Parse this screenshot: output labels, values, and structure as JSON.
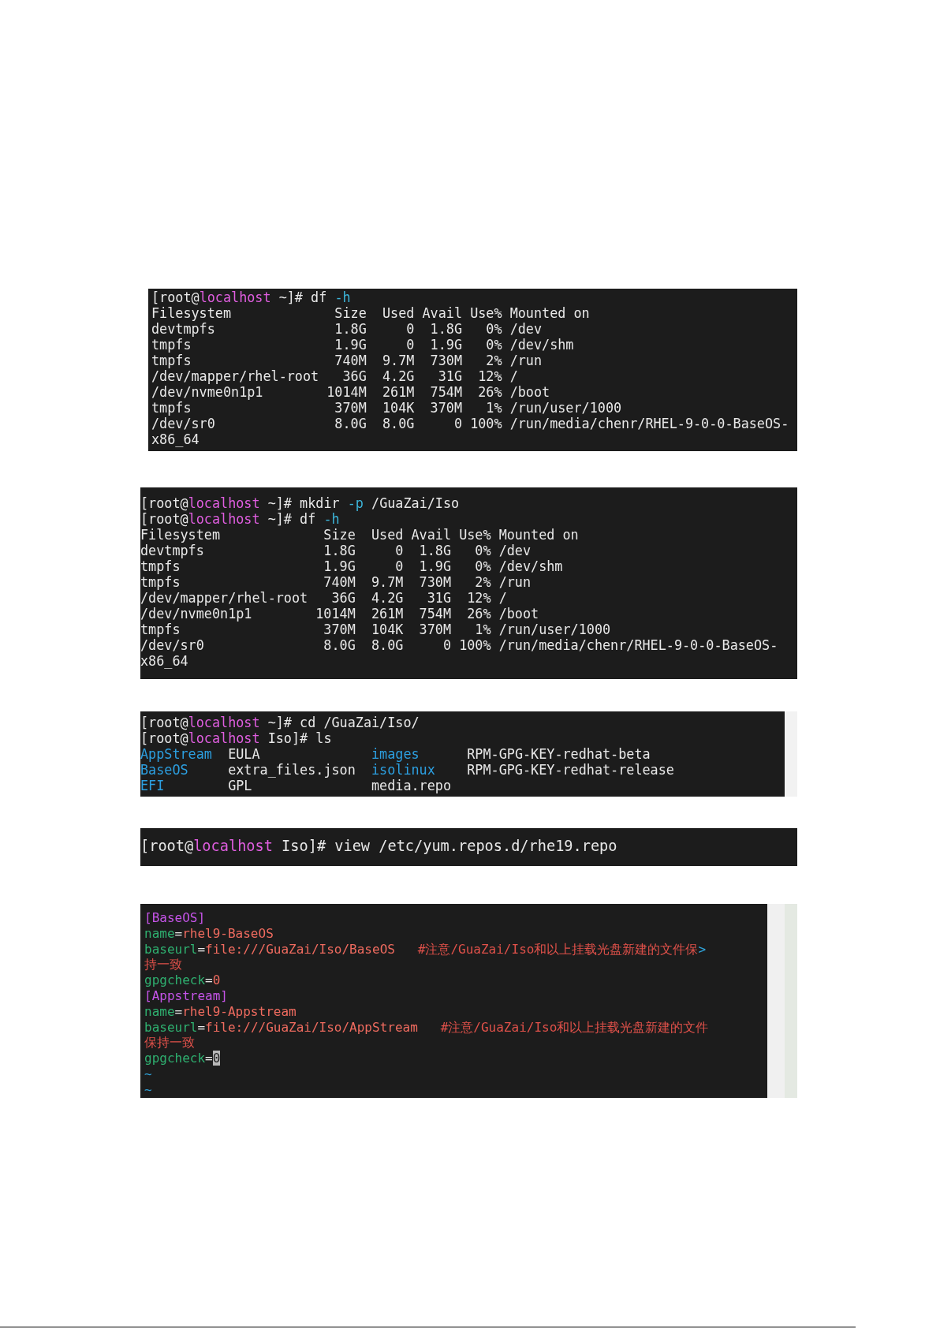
{
  "terminals": [
    {
      "kind": "normal",
      "scrollbar": false,
      "lines": [
        [
          {
            "text": "[root@",
            "kind": "plain"
          },
          {
            "text": "localhost",
            "kind": "host"
          },
          {
            "text": " ~]# df ",
            "kind": "plain"
          },
          {
            "text": "-h",
            "kind": "option"
          }
        ],
        [
          {
            "text": "Filesystem             Size  Used Avail Use% Mounted on",
            "kind": "plain"
          }
        ],
        [
          {
            "text": "devtmpfs               1.8G     0  1.8G   0% /dev",
            "kind": "plain"
          }
        ],
        [
          {
            "text": "tmpfs                  1.9G     0  1.9G   0% /dev/shm",
            "kind": "plain"
          }
        ],
        [
          {
            "text": "tmpfs                  740M  9.7M  730M   2% /run",
            "kind": "plain"
          }
        ],
        [
          {
            "text": "/dev/mapper/rhel-root   36G  4.2G   31G  12% /",
            "kind": "plain"
          }
        ],
        [
          {
            "text": "/dev/nvme0n1p1        1014M  261M  754M  26% /boot",
            "kind": "plain"
          }
        ],
        [
          {
            "text": "tmpfs                  370M  104K  370M   1% /run/user/1000",
            "kind": "plain"
          }
        ],
        [
          {
            "text": "/dev/sr0               8.0G  8.0G     0 100% /run/media/chenr/RHEL-9-0-0-BaseOS-",
            "kind": "plain"
          }
        ],
        [
          {
            "text": "x86_64",
            "kind": "plain"
          }
        ]
      ]
    },
    {
      "kind": "normal",
      "scrollbar": false,
      "lines": [
        [
          {
            "text": "[root@",
            "kind": "plain"
          },
          {
            "text": "localhost",
            "kind": "host"
          },
          {
            "text": " ~]# mkdir ",
            "kind": "plain"
          },
          {
            "text": "-p",
            "kind": "option"
          },
          {
            "text": " /GuaZai/Iso",
            "kind": "plain"
          }
        ],
        [
          {
            "text": "[root@",
            "kind": "plain"
          },
          {
            "text": "localhost",
            "kind": "host"
          },
          {
            "text": " ~]# df ",
            "kind": "plain"
          },
          {
            "text": "-h",
            "kind": "option"
          }
        ],
        [
          {
            "text": "Filesystem             Size  Used Avail Use% Mounted on",
            "kind": "plain"
          }
        ],
        [
          {
            "text": "devtmpfs               1.8G     0  1.8G   0% /dev",
            "kind": "plain"
          }
        ],
        [
          {
            "text": "tmpfs                  1.9G     0  1.9G   0% /dev/shm",
            "kind": "plain"
          }
        ],
        [
          {
            "text": "tmpfs                  740M  9.7M  730M   2% /run",
            "kind": "plain"
          }
        ],
        [
          {
            "text": "/dev/mapper/rhel-root   36G  4.2G   31G  12% /",
            "kind": "plain"
          }
        ],
        [
          {
            "text": "/dev/nvme0n1p1        1014M  261M  754M  26% /boot",
            "kind": "plain"
          }
        ],
        [
          {
            "text": "tmpfs                  370M  104K  370M   1% /run/user/1000",
            "kind": "plain"
          }
        ],
        [
          {
            "text": "/dev/sr0               8.0G  8.0G     0 100% /run/media/chenr/RHEL-9-0-0-BaseOS-",
            "kind": "plain"
          }
        ],
        [
          {
            "text": "x86_64",
            "kind": "plain"
          }
        ]
      ]
    },
    {
      "kind": "normal",
      "scrollbar": true,
      "lines": [
        [
          {
            "text": "[root@",
            "kind": "plain"
          },
          {
            "text": "localhost",
            "kind": "host"
          },
          {
            "text": " ~]# cd /GuaZai/Iso/",
            "kind": "plain"
          }
        ],
        [
          {
            "text": "[root@",
            "kind": "plain"
          },
          {
            "text": "localhost",
            "kind": "host"
          },
          {
            "text": " Iso]# ls",
            "kind": "plain"
          }
        ],
        [
          {
            "text": "AppStream",
            "kind": "dir"
          },
          {
            "text": "  EULA              ",
            "kind": "plain"
          },
          {
            "text": "images",
            "kind": "dir"
          },
          {
            "text": "      RPM-GPG-KEY-redhat-beta",
            "kind": "plain"
          }
        ],
        [
          {
            "text": "BaseOS",
            "kind": "dir"
          },
          {
            "text": "     extra_files.json  ",
            "kind": "plain"
          },
          {
            "text": "isolinux",
            "kind": "dir"
          },
          {
            "text": "    RPM-GPG-KEY-redhat-release",
            "kind": "plain"
          }
        ],
        [
          {
            "text": "EFI",
            "kind": "dir"
          },
          {
            "text": "        GPL               media.repo",
            "kind": "plain"
          }
        ]
      ]
    },
    {
      "kind": "large",
      "scrollbar": false,
      "lines": [
        [
          {
            "text": "[root@",
            "kind": "plain"
          },
          {
            "text": "localhost",
            "kind": "host"
          },
          {
            "text": " Iso]# view /etc/yum.repos.d/rhe19.repo",
            "kind": "plain"
          }
        ]
      ]
    },
    {
      "kind": "small",
      "scrollbar": true,
      "lines": [
        [
          {
            "text": "[BaseOS]",
            "kind": "section"
          }
        ],
        [
          {
            "text": "name",
            "kind": "key"
          },
          {
            "text": "=",
            "kind": "plain"
          },
          {
            "text": "rhel9-BaseOS",
            "kind": "value"
          }
        ],
        [
          {
            "text": "baseurl",
            "kind": "key"
          },
          {
            "text": "=",
            "kind": "plain"
          },
          {
            "text": "file:///GuaZai/Iso/BaseOS",
            "kind": "value"
          },
          {
            "text": "   #注意/GuaZai/Iso和以上挂载光盘新建的文件保",
            "kind": "comment"
          },
          {
            "text": ">",
            "kind": "tilde"
          }
        ],
        [
          {
            "text": "持一致",
            "kind": "comment"
          }
        ],
        [
          {
            "text": "gpgcheck",
            "kind": "key"
          },
          {
            "text": "=",
            "kind": "plain"
          },
          {
            "text": "0",
            "kind": "value"
          }
        ],
        [
          {
            "text": "[Appstream]",
            "kind": "section"
          }
        ],
        [
          {
            "text": "name",
            "kind": "key"
          },
          {
            "text": "=",
            "kind": "plain"
          },
          {
            "text": "rhel9-Appstream",
            "kind": "value"
          }
        ],
        [
          {
            "text": "baseurl",
            "kind": "key"
          },
          {
            "text": "=",
            "kind": "plain"
          },
          {
            "text": "file:///GuaZai/Iso/AppStream",
            "kind": "value"
          },
          {
            "text": "   #注意/GuaZai/Iso和以上挂载光盘新建的文件",
            "kind": "comment"
          }
        ],
        [
          {
            "text": "保持一致",
            "kind": "comment"
          }
        ],
        [
          {
            "text": "gpgcheck",
            "kind": "key"
          },
          {
            "text": "=",
            "kind": "plain"
          },
          {
            "text": "0",
            "kind": "cursor"
          }
        ],
        [
          {
            "text": "~",
            "kind": "tilde"
          }
        ],
        [
          {
            "text": "~",
            "kind": "tilde"
          }
        ]
      ]
    }
  ]
}
